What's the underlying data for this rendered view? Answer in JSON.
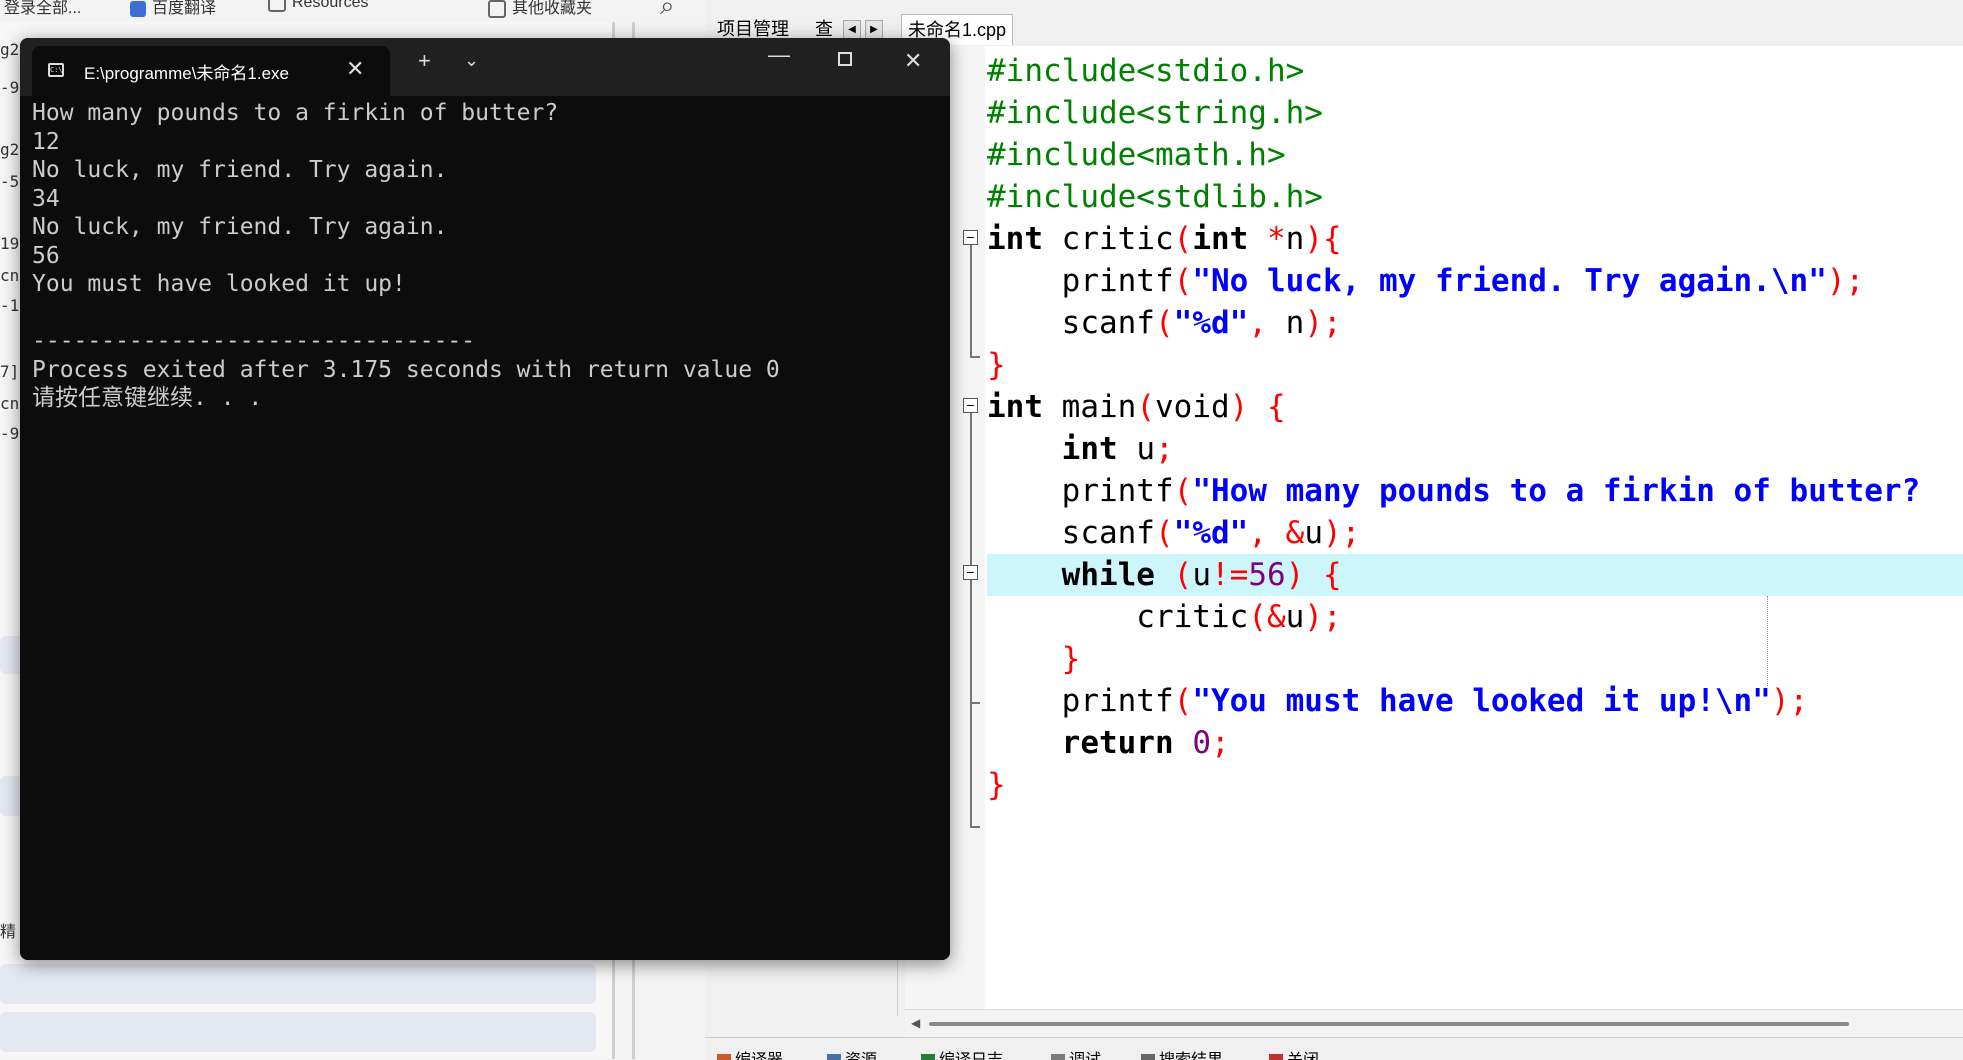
{
  "browser": {
    "tabs": [
      "登录全部...",
      "百度翻译",
      "Resources",
      "其他收藏夹"
    ],
    "left_strip": [
      "g2",
      "-9",
      "g2",
      "-5",
      "19",
      "cn",
      "-1",
      "7]",
      "cn",
      "-9",
      "精"
    ]
  },
  "ide": {
    "left_tabs": [
      "项目管理",
      "查"
    ],
    "file_tab": "未命名1.cpp",
    "bottom_tabs": [
      "编译器",
      "资源",
      "编译日志",
      "调试",
      "搜索结果",
      "关闭"
    ],
    "code": [
      {
        "tokens": [
          {
            "c": "pp",
            "t": "#include<stdio.h>"
          }
        ]
      },
      {
        "tokens": [
          {
            "c": "pp",
            "t": "#include<string.h>"
          }
        ]
      },
      {
        "tokens": [
          {
            "c": "pp",
            "t": "#include<math.h>"
          }
        ]
      },
      {
        "tokens": [
          {
            "c": "pp",
            "t": "#include<stdlib.h>"
          }
        ]
      },
      {
        "tokens": [
          {
            "c": "kw",
            "t": "int"
          },
          {
            "c": "id",
            "t": " critic"
          },
          {
            "c": "sym",
            "t": "("
          },
          {
            "c": "kw",
            "t": "int"
          },
          {
            "c": "id",
            "t": " "
          },
          {
            "c": "sym",
            "t": "*"
          },
          {
            "c": "id",
            "t": "n"
          },
          {
            "c": "sym",
            "t": "){"
          }
        ]
      },
      {
        "tokens": [
          {
            "c": "id",
            "t": "    printf"
          },
          {
            "c": "sym",
            "t": "("
          },
          {
            "c": "str",
            "t": "\"No luck, my friend. Try again.\\n\""
          },
          {
            "c": "sym",
            "t": ");"
          }
        ]
      },
      {
        "tokens": [
          {
            "c": "id",
            "t": "    scanf"
          },
          {
            "c": "sym",
            "t": "("
          },
          {
            "c": "str",
            "t": "\"%d\""
          },
          {
            "c": "sym",
            "t": ","
          },
          {
            "c": "id",
            "t": " n"
          },
          {
            "c": "sym",
            "t": ");"
          }
        ]
      },
      {
        "tokens": [
          {
            "c": "sym",
            "t": "}"
          }
        ]
      },
      {
        "tokens": [
          {
            "c": "kw",
            "t": "int"
          },
          {
            "c": "id",
            "t": " main"
          },
          {
            "c": "sym",
            "t": "("
          },
          {
            "c": "id",
            "t": "void"
          },
          {
            "c": "sym",
            "t": ")"
          },
          {
            "c": "id",
            "t": " "
          },
          {
            "c": "sym",
            "t": "{"
          }
        ]
      },
      {
        "tokens": [
          {
            "c": "kw",
            "t": "    int"
          },
          {
            "c": "id",
            "t": " u"
          },
          {
            "c": "sym",
            "t": ";"
          }
        ]
      },
      {
        "tokens": [
          {
            "c": "id",
            "t": "    printf"
          },
          {
            "c": "sym",
            "t": "("
          },
          {
            "c": "str",
            "t": "\"How many pounds to a firkin of butter?"
          }
        ]
      },
      {
        "tokens": [
          {
            "c": "id",
            "t": "    scanf"
          },
          {
            "c": "sym",
            "t": "("
          },
          {
            "c": "str",
            "t": "\"%d\""
          },
          {
            "c": "sym",
            "t": ","
          },
          {
            "c": "id",
            "t": " "
          },
          {
            "c": "sym",
            "t": "&"
          },
          {
            "c": "id",
            "t": "u"
          },
          {
            "c": "sym",
            "t": ");"
          }
        ]
      },
      {
        "tokens": [
          {
            "c": "kw",
            "t": "    while"
          },
          {
            "c": "id",
            "t": " "
          },
          {
            "c": "sym",
            "t": "("
          },
          {
            "c": "id",
            "t": "u"
          },
          {
            "c": "sym",
            "t": "!="
          },
          {
            "c": "num",
            "t": "56"
          },
          {
            "c": "sym",
            "t": ")"
          },
          {
            "c": "id",
            "t": " "
          },
          {
            "c": "sym",
            "t": "{"
          }
        ],
        "highlight": true
      },
      {
        "tokens": [
          {
            "c": "id",
            "t": "        critic"
          },
          {
            "c": "sym",
            "t": "(&"
          },
          {
            "c": "id",
            "t": "u"
          },
          {
            "c": "sym",
            "t": ");"
          }
        ]
      },
      {
        "tokens": [
          {
            "c": "sym",
            "t": "    }"
          }
        ]
      },
      {
        "tokens": [
          {
            "c": "id",
            "t": "    printf"
          },
          {
            "c": "sym",
            "t": "("
          },
          {
            "c": "str",
            "t": "\"You must have looked it up!\\n\""
          },
          {
            "c": "sym",
            "t": ");"
          }
        ]
      },
      {
        "tokens": [
          {
            "c": "kw",
            "t": "    return"
          },
          {
            "c": "id",
            "t": " "
          },
          {
            "c": "num",
            "t": "0"
          },
          {
            "c": "sym",
            "t": ";"
          }
        ]
      },
      {
        "tokens": [
          {
            "c": "sym",
            "t": "}"
          }
        ]
      }
    ]
  },
  "terminal": {
    "tab_title": "E:\\programme\\未命名1.exe",
    "lines": [
      "How many pounds to a firkin of butter?",
      "12",
      "No luck, my friend. Try again.",
      "34",
      "No luck, my friend. Try again.",
      "56",
      "You must have looked it up!",
      "",
      "--------------------------------",
      "Process exited after 3.175 seconds with return value 0",
      "请按任意键继续. . ."
    ]
  }
}
